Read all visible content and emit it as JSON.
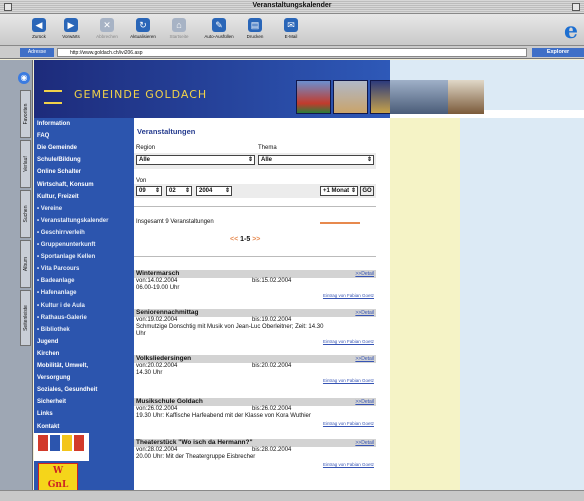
{
  "window": {
    "title": "Veranstaltungskalender"
  },
  "toolbar": {
    "buttons": [
      {
        "label": "Zurück",
        "icon": "back-icon",
        "enabled": true
      },
      {
        "label": "Vorwärts",
        "icon": "forward-icon",
        "enabled": true
      },
      {
        "label": "Abbrechen",
        "icon": "stop-icon",
        "enabled": false
      },
      {
        "label": "Aktualisieren",
        "icon": "refresh-icon",
        "enabled": true
      },
      {
        "label": "Startseite",
        "icon": "home-icon",
        "enabled": false
      },
      {
        "label": "Auto-Ausfüllen",
        "icon": "autofill-icon",
        "enabled": true
      },
      {
        "label": "Drucken",
        "icon": "print-icon",
        "enabled": true
      },
      {
        "label": "E-Mail",
        "icon": "mail-icon",
        "enabled": true
      }
    ]
  },
  "address": {
    "label": "Adresse",
    "url": "http://www.goldach.ch/ivi206.asp",
    "go_label": "Explorer"
  },
  "explorer_tabs": [
    "Favoriten",
    "Verlauf",
    "Suchen",
    "Album",
    "Seitenleiste"
  ],
  "banner": {
    "gemeinde_name": "GEMEINDE GOLDACH"
  },
  "nav": [
    {
      "label": "Information",
      "sub": false
    },
    {
      "label": "FAQ",
      "sub": false
    },
    {
      "label": "Die Gemeinde",
      "sub": false
    },
    {
      "label": "Schule/Bildung",
      "sub": false
    },
    {
      "label": "Online Schalter",
      "sub": false
    },
    {
      "label": "Wirtschaft, Konsum",
      "sub": false
    },
    {
      "label": "Kultur, Freizeit",
      "sub": false
    },
    {
      "label": "• Vereine",
      "sub": true
    },
    {
      "label": "• Veranstaltungskalender",
      "sub": true
    },
    {
      "label": "• Geschirrverleih",
      "sub": true
    },
    {
      "label": "• Gruppenunterkunft",
      "sub": true
    },
    {
      "label": "• Sportanlage Kellen",
      "sub": true
    },
    {
      "label": "• Vita Parcours",
      "sub": true
    },
    {
      "label": "• Badeanlage",
      "sub": true
    },
    {
      "label": "• Hafenanlage",
      "sub": true
    },
    {
      "label": "• Kultur i de Aula",
      "sub": true
    },
    {
      "label": "• Rathaus-Galerie",
      "sub": true
    },
    {
      "label": "• Bibliothek",
      "sub": true
    },
    {
      "label": "Jugend",
      "sub": false
    },
    {
      "label": "Kirchen",
      "sub": false
    },
    {
      "label": "Mobilität, Umwelt,",
      "sub": false
    },
    {
      "label": "Versorgung",
      "sub": false
    },
    {
      "label": "Soziales, Gesundheit",
      "sub": false
    },
    {
      "label": "Sicherheit",
      "sub": false
    },
    {
      "label": "Links",
      "sub": false
    },
    {
      "label": "Kontakt",
      "sub": false
    }
  ],
  "main": {
    "heading": "Veranstaltungen",
    "region_label": "Region",
    "region_value": "Alle",
    "thema_label": "Thema",
    "thema_value": "Alle",
    "von_label": "Von",
    "day": "09",
    "month": "02",
    "year": "2004",
    "period": "+1 Monat",
    "go": "GO",
    "total": "Insgesamt 9 Veranstaltungen",
    "pager_prev": "<<",
    "pager_range": "1-5",
    "pager_next": ">>"
  },
  "events": [
    {
      "title": "Wintermarsch",
      "detail": ">>Detail",
      "von": "von:14.02.2004",
      "bis": "bis:15.02.2004",
      "lines": [
        "06.00-19.00 Uhr"
      ],
      "link": "Eintrag von Fabian Goetz"
    },
    {
      "title": "Seniorennachmittag",
      "detail": ">>Detail",
      "von": "von:19.02.2004",
      "bis": "bis:19.02.2004",
      "lines": [
        "Schmutzige Donschtig mit Musik von Jean-Luc Oberleitner; Zeit: 14.30",
        "Uhr"
      ],
      "link": "Eintrag von Fabian Goetz"
    },
    {
      "title": "Volksliedersingen",
      "detail": ">>Detail",
      "von": "von:20.02.2004",
      "bis": "bis:20.02.2004",
      "lines": [
        "14.30 Uhr"
      ],
      "link": "Eintrag von Fabian Goetz"
    },
    {
      "title": "Musikschule Goldach",
      "detail": ">>Detail",
      "von": "von:26.02.2004",
      "bis": "bis:26.02.2004",
      "lines": [
        "19.30 Uhr: Kaffische Harfeabend mit der Klasse von Kora Wuthier"
      ],
      "link": "Eintrag von Fabian Goetz"
    },
    {
      "title": "Theaterstück \"Wo isch da Hermann?\"",
      "detail": ">>Detail",
      "von": "von:28.02.2004",
      "bis": "bis:28.02.2004",
      "lines": [
        "20.00 Uhr: Mit der Theatergruppe Eisbrecher"
      ],
      "link": "Eintrag von Fabian Goetz"
    }
  ],
  "colors": {
    "nav_bg": "#2c55ae",
    "accent_orange": "#e7894e",
    "link_blue": "#3654b4",
    "banner_gold": "#f0d24a"
  }
}
